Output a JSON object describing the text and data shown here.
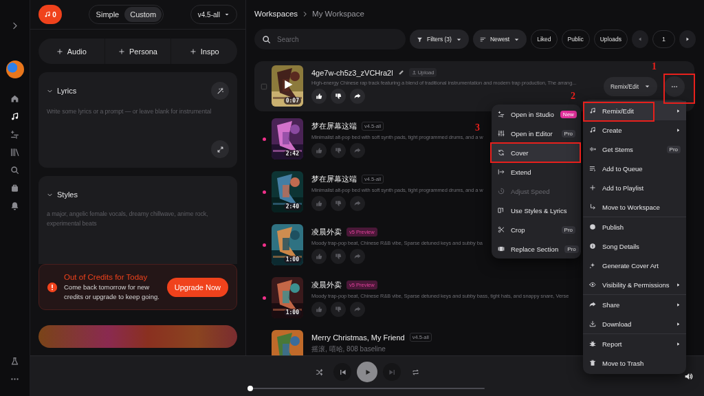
{
  "rail": {
    "items": [
      {
        "selected": false
      },
      {
        "selected": true
      },
      {
        "selected": false
      },
      {
        "selected": false
      },
      {
        "selected": false
      },
      {
        "selected": false
      },
      {
        "selected": false
      }
    ]
  },
  "composer": {
    "credits": "0",
    "mode_tabs": [
      {
        "label": "Simple",
        "selected": false
      },
      {
        "label": "Custom",
        "selected": true
      }
    ],
    "model": "v4.5-all",
    "add_buttons": [
      "Audio",
      "Persona",
      "Inspo"
    ],
    "lyrics": {
      "title": "Lyrics",
      "placeholder": "Write some lyrics or a prompt — or leave blank for instrumental"
    },
    "styles": {
      "title": "Styles",
      "placeholder": "a major, angelic female vocals, dreamy chillwave, anime rock, experimental beats"
    },
    "alert": {
      "title": "Out of Credits for Today",
      "message": "Come back tomorrow for new credits or upgrade to keep going.",
      "button": "Upgrade Now"
    }
  },
  "breadcrumb": [
    "Workspaces",
    "My Workspace"
  ],
  "search": {
    "placeholder": "Search"
  },
  "filters": "Filters (3)",
  "sort": "Newest",
  "filter_chips": [
    "Liked",
    "Public",
    "Uploads"
  ],
  "page": "1",
  "tracks": [
    {
      "title": "4ge7w-ch5z3_zVCHra2l",
      "tag": {
        "text": "Upload",
        "kind": "upload"
      },
      "description": "High-energy Chinese rap track featuring a blend of traditional instrumentation and modern trap production, The arrang...",
      "duration": "0:07",
      "selected": true,
      "new": false,
      "action": "Remix/Edit"
    },
    {
      "title": "梦在屏幕这端",
      "tag": {
        "text": "v4.5-all",
        "kind": "version"
      },
      "description": "Minimalist alt-pop bed with soft synth pads, tight programmed drums, and a w",
      "duration": "2:42",
      "selected": false,
      "new": true
    },
    {
      "title": "梦在屏幕这端",
      "tag": {
        "text": "v4.5-all",
        "kind": "version"
      },
      "description": "Minimalist alt-pop bed with soft synth pads, tight programmed drums, and a w",
      "duration": "2:40",
      "selected": false,
      "new": true
    },
    {
      "title": "凌晨外卖",
      "tag": {
        "text": "v5 Preview",
        "kind": "preview"
      },
      "description": "Moody trap-pop beat, Chinese R&B vibe, Sparse detuned keys and subby ba",
      "duration": "1:00",
      "selected": false,
      "new": true
    },
    {
      "title": "凌晨外卖",
      "tag": {
        "text": "v5 Preview",
        "kind": "preview"
      },
      "description": "Moody trap-pop beat, Chinese R&B vibe, Sparse detuned keys and subby bass, tight hats, and snappy snare, Verse",
      "duration": "1:00",
      "selected": false,
      "new": true
    },
    {
      "title": "Merry Christmas, My Friend",
      "tag": {
        "text": "v4.5-all",
        "kind": "version"
      },
      "description": "摇滚, 嘻哈, 808 baseline",
      "selected": false,
      "new": false
    }
  ],
  "context_menu": {
    "groups": [
      [
        {
          "label": "Remix/Edit",
          "submenu": true,
          "selected": true
        },
        {
          "label": "Create",
          "submenu": true,
          "selected": false
        },
        {
          "label": "Get Stems",
          "badge": "Pro",
          "submenu": false,
          "selected": false
        },
        {
          "label": "Add to Queue",
          "submenu": false,
          "selected": false
        },
        {
          "label": "Add to Playlist",
          "submenu": false,
          "selected": false
        },
        {
          "label": "Move to Workspace",
          "submenu": false,
          "selected": false
        }
      ],
      [
        {
          "label": "Publish",
          "submenu": false,
          "selected": false
        },
        {
          "label": "Song Details",
          "submenu": false,
          "selected": false
        },
        {
          "label": "Generate Cover Art",
          "submenu": false,
          "selected": false
        },
        {
          "label": "Visibility & Permissions",
          "submenu": true,
          "selected": false
        }
      ],
      [
        {
          "label": "Share",
          "submenu": true,
          "selected": false
        },
        {
          "label": "Download",
          "submenu": true,
          "selected": false
        }
      ],
      [
        {
          "label": "Report",
          "submenu": true,
          "selected": false
        },
        {
          "label": "Move to Trash",
          "submenu": false,
          "selected": false
        }
      ]
    ]
  },
  "submenu": {
    "items": [
      {
        "label": "Open in Studio",
        "badge": {
          "text": "New",
          "kind": "new"
        },
        "selected": false,
        "disabled": false
      },
      {
        "label": "Open in Editor",
        "badge": {
          "text": "Pro",
          "kind": "pro"
        },
        "selected": false,
        "disabled": false
      },
      {
        "label": "Cover",
        "selected": true,
        "disabled": false
      },
      {
        "label": "Extend",
        "selected": false,
        "disabled": false
      },
      {
        "label": "Adjust Speed",
        "selected": false,
        "disabled": true
      },
      {
        "label": "Use Styles & Lyrics",
        "selected": false,
        "disabled": false
      },
      {
        "label": "Crop",
        "badge": {
          "text": "Pro",
          "kind": "pro"
        },
        "selected": false,
        "disabled": false
      },
      {
        "label": "Replace Section",
        "badge": {
          "text": "Pro",
          "kind": "pro"
        },
        "selected": false,
        "disabled": false
      }
    ]
  },
  "annotations": [
    "1",
    "2",
    "3"
  ],
  "player": {
    "level": 0
  }
}
